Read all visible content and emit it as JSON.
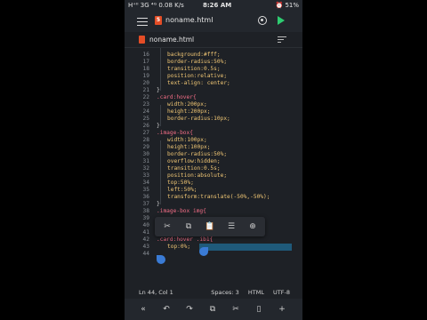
{
  "status_bar": {
    "left": "H⁺ᴵᴵ 3G ⁴ᴳ 0.08 K/s",
    "time": "8:26 AM",
    "right": "⏰ 51%"
  },
  "app_bar": {
    "html_icon_label": "5",
    "title": "noname.html"
  },
  "file_tab": {
    "name": "noname.html"
  },
  "code_lines": [
    {
      "n": "16",
      "indent": 1,
      "kind": "prop",
      "text": "background:#fff;"
    },
    {
      "n": "17",
      "indent": 1,
      "kind": "prop",
      "text": "border-radius:50%;"
    },
    {
      "n": "18",
      "indent": 1,
      "kind": "prop",
      "text": "transition:0.5s;"
    },
    {
      "n": "19",
      "indent": 1,
      "kind": "prop",
      "text": "position:relative;"
    },
    {
      "n": "20",
      "indent": 1,
      "kind": "prop",
      "text": "text-align: center;"
    },
    {
      "n": "21",
      "indent": 0,
      "kind": "close",
      "text": "}"
    },
    {
      "n": "22",
      "indent": 0,
      "kind": "sel",
      "text": ".card:hover{"
    },
    {
      "n": "23",
      "indent": 1,
      "kind": "prop",
      "text": "width:200px;"
    },
    {
      "n": "24",
      "indent": 1,
      "kind": "prop",
      "text": "height:200px;"
    },
    {
      "n": "25",
      "indent": 1,
      "kind": "prop",
      "text": "border-radius:10px;"
    },
    {
      "n": "26",
      "indent": 0,
      "kind": "close",
      "text": "}"
    },
    {
      "n": "27",
      "indent": 0,
      "kind": "sel",
      "text": ".image-box{"
    },
    {
      "n": "28",
      "indent": 1,
      "kind": "prop",
      "text": "width:100px;"
    },
    {
      "n": "29",
      "indent": 1,
      "kind": "prop",
      "text": "height:100px;"
    },
    {
      "n": "30",
      "indent": 1,
      "kind": "prop",
      "text": "border-radius:50%;"
    },
    {
      "n": "31",
      "indent": 1,
      "kind": "prop",
      "text": "overflow:hidden;"
    },
    {
      "n": "32",
      "indent": 1,
      "kind": "prop",
      "text": "transition:0.5s;"
    },
    {
      "n": "33",
      "indent": 1,
      "kind": "prop",
      "text": "position:absolute;"
    },
    {
      "n": "34",
      "indent": 1,
      "kind": "prop",
      "text": "top:50%;"
    },
    {
      "n": "35",
      "indent": 1,
      "kind": "prop",
      "text": "left:50%;"
    },
    {
      "n": "36",
      "indent": 1,
      "kind": "prop",
      "text": "transform:translate(-50%,-50%);"
    },
    {
      "n": "37",
      "indent": 0,
      "kind": "close",
      "text": "}"
    },
    {
      "n": "38",
      "indent": 0,
      "kind": "sel",
      "text": ".image-box img{"
    },
    {
      "n": "39",
      "indent": 0,
      "kind": "blank",
      "text": ""
    },
    {
      "n": "40",
      "indent": 0,
      "kind": "blank",
      "text": ""
    },
    {
      "n": "41",
      "indent": 0,
      "kind": "blank",
      "text": ""
    },
    {
      "n": "42",
      "indent": 0,
      "kind": "sel",
      "text": ".card:hover .ib1{"
    },
    {
      "n": "43",
      "indent": 1,
      "kind": "prop",
      "text": "top:0%;"
    },
    {
      "n": "44",
      "indent": 0,
      "kind": "blank",
      "text": ""
    }
  ],
  "selection_popup": {
    "items": [
      "cut-icon",
      "copy-icon",
      "paste-icon",
      "select-all-icon",
      "web-search-icon"
    ]
  },
  "editor_status": {
    "position": "Ln 44, Col 1",
    "spaces": "Spaces: 3",
    "language": "HTML",
    "encoding": "UTF-8"
  },
  "bottom_toolbar": {
    "items": [
      "tab-icon",
      "undo-icon",
      "redo-icon",
      "duplicate-icon",
      "cut-icon",
      "paste-icon",
      "add-icon"
    ]
  },
  "colors": {
    "editor_bg": "#1e2126",
    "property": "#f0c674",
    "selector": "#f26d85",
    "line_number": "#8a8f96",
    "selection": "#1f5a7a",
    "run_button": "#2ecc71",
    "html_icon": "#e44d26"
  }
}
